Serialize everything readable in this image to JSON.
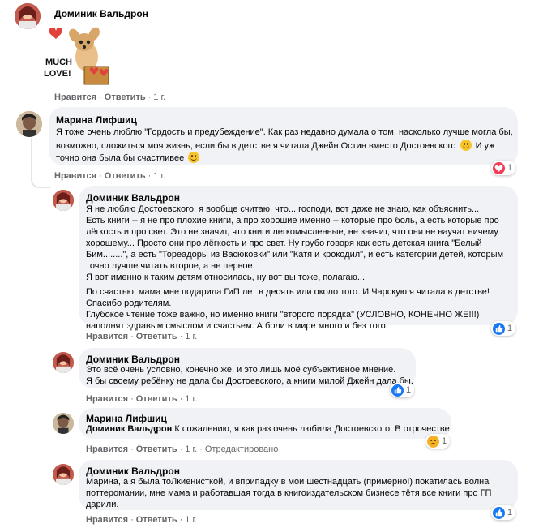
{
  "top": {
    "author": "Доминик Вальдрон",
    "sticker_text": [
      "MUCH",
      "LOVE!"
    ],
    "actions": {
      "like": "Нравится",
      "reply": "Ответить",
      "time": "1 г."
    }
  },
  "c1": {
    "author": "Марина Лифшиц",
    "lines": [
      "Я тоже очень люблю \"Гордость и предубеждение\". Как раз недавно думала о том, насколько лучше могла бы,",
      "возможно, сложиться моя жизнь, если бы в детстве я читала Джейн Остин вместо Достоевского",
      "И уж",
      "точно она была бы счастливее"
    ],
    "actions": {
      "like": "Нравится",
      "reply": "Ответить",
      "time": "1 г."
    },
    "reaction": {
      "icon": "heart-icon",
      "count": "1",
      "color": "#f33e58"
    }
  },
  "c2": {
    "author": "Доминик Вальдрон",
    "lines": [
      "Я не люблю Достоевского, я вообще считаю, что... господи, вот даже не знаю, как объяснить...",
      "Есть книги -- я не про плохие книги, а про хорошие именно -- которые про боль, а есть которые про",
      "лёгкость и про свет. Это не значит, что книги легкомысленные, не значит, что они не научат ничему",
      "хорошему... Просто они про лёгкость и про свет. Ну грубо говоря как есть детская книга \"Белый",
      "Бим........\", а есть \"Тореадоры из Васюковки\" или \"Катя и крокодил\", и есть категории детей, которым",
      "точно лучше читать второе, а не первое.",
      "Я вот именно к таким детям относилась, ну вот вы тоже, полагаю..."
    ],
    "lines2": [
      "По счастью, мама мне подарила ГиП лет в десять или около того. И Чарскую я читала в детстве!",
      "Спасибо родителям.",
      "Глубокое чтение тоже важно, но именно книги \"второго порядка\" (УСЛОВНО, КОНЕЧНО ЖЕ!!!)",
      "наполнят здравым смыслом и счастьем. А боли в мире много и без того."
    ],
    "actions": {
      "like": "Нравится",
      "reply": "Ответить",
      "time": "1 г."
    },
    "reaction": {
      "icon": "like-icon",
      "count": "1",
      "color": "#1877f2"
    }
  },
  "c3": {
    "author": "Доминик Вальдрон",
    "lines": [
      "Это всё очень условно, конечно же, и это лишь моё субъективное мнение.",
      "Я бы своему ребёнку не дала бы Достоевского, а книги милой Джейн дала бы."
    ],
    "actions": {
      "like": "Нравится",
      "reply": "Ответить",
      "time": "1 г."
    },
    "reaction": {
      "icon": "like-icon",
      "count": "1",
      "color": "#1877f2"
    }
  },
  "c4": {
    "author": "Марина Лифшиц",
    "mention": "Доминик Вальдрон",
    "text": "К сожалению, я как раз очень любила Достоевского. В отрочестве.",
    "actions": {
      "like": "Нравится",
      "reply": "Ответить",
      "time": "1 г.",
      "edited": "Отредактировано"
    },
    "reaction": {
      "icon": "sad-icon",
      "count": "1",
      "color": "#f7b125"
    }
  },
  "c5": {
    "author": "Доминик Вальдрон",
    "lines": [
      "Марина, а я была тоЛкиенисткой, и вприпадку в мои шестнадцать (примерно!) покатилась волна",
      "поттеромании, мне мама и работавшая тогда в книгоиздательском бизнесе тётя все книги про ГП",
      "дарили."
    ],
    "actions": {
      "like": "Нравится",
      "reply": "Ответить",
      "time": "1 г."
    },
    "reaction": {
      "icon": "like-icon",
      "count": "1",
      "color": "#1877f2"
    }
  }
}
